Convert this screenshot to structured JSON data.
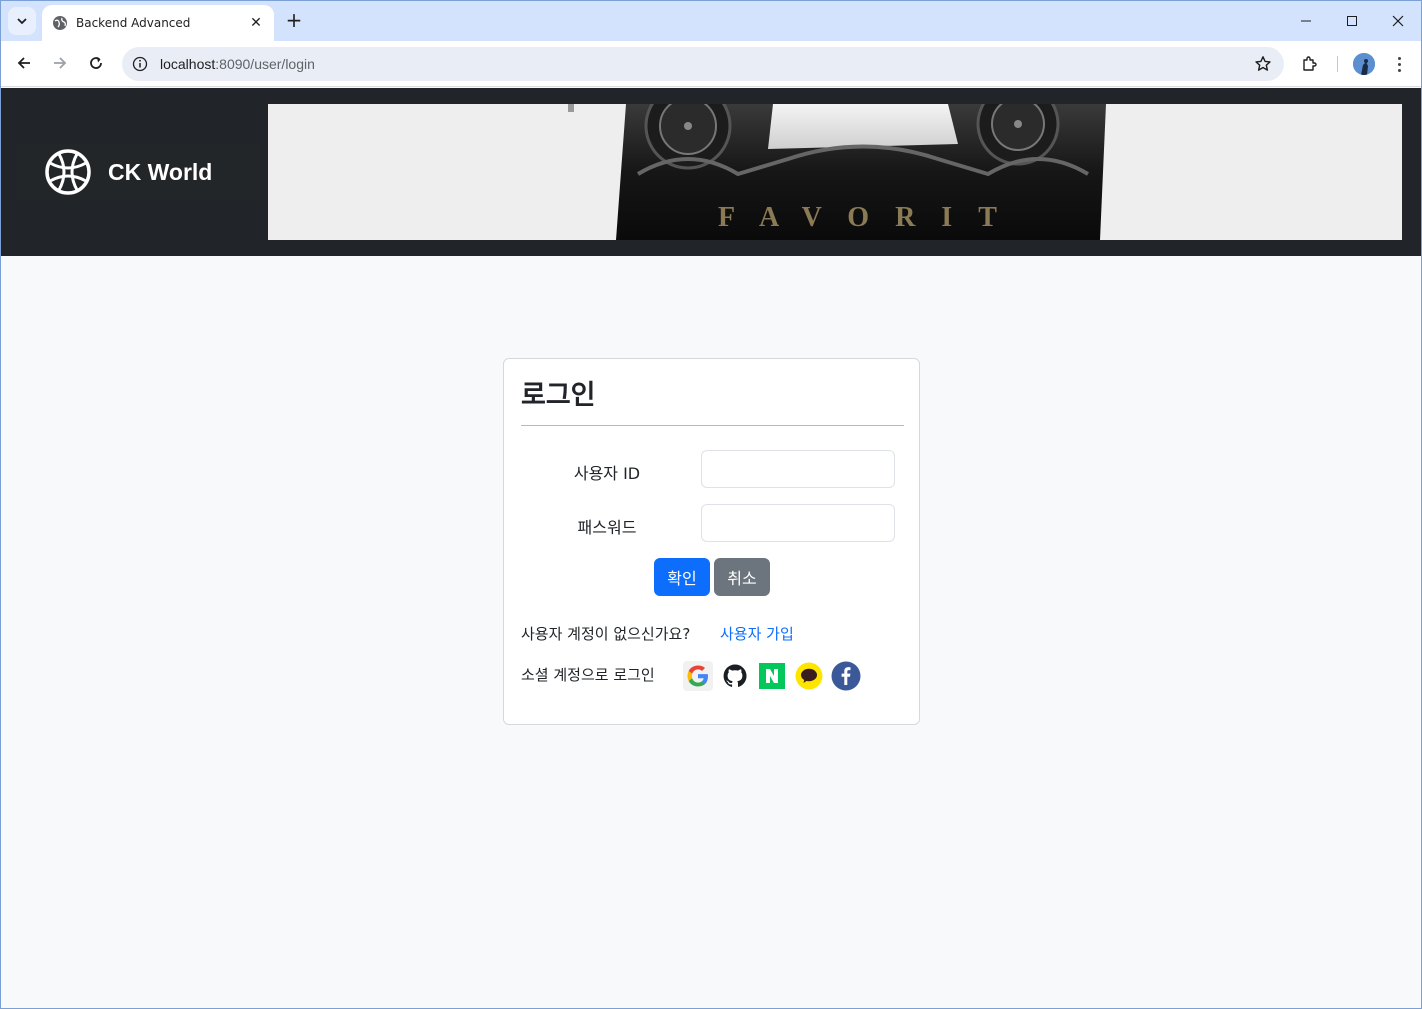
{
  "browser": {
    "tab_title": "Backend Advanced",
    "tab_close": "✕",
    "new_tab": "+",
    "url_host": "localhost",
    "url_path": ":8090/user/login"
  },
  "header": {
    "brand_name": "CK World",
    "banner_text": "FAVORIT"
  },
  "login": {
    "title": "로그인",
    "user_id_label": "사용자 ID",
    "user_id_value": "",
    "password_label": "패스워드",
    "password_value": "",
    "confirm_label": "확인",
    "cancel_label": "취소",
    "no_account_text": "사용자 계정이 없으신가요?",
    "signup_link": "사용자 가입",
    "social_text": "소셜 계정으로 로그인",
    "social_providers": [
      "google-icon",
      "github-icon",
      "naver-icon",
      "kakao-icon",
      "facebook-icon"
    ]
  },
  "colors": {
    "primary": "#0d6efd",
    "secondary": "#6c757d",
    "header_bg": "#212529",
    "page_bg": "#f8f9fa"
  }
}
